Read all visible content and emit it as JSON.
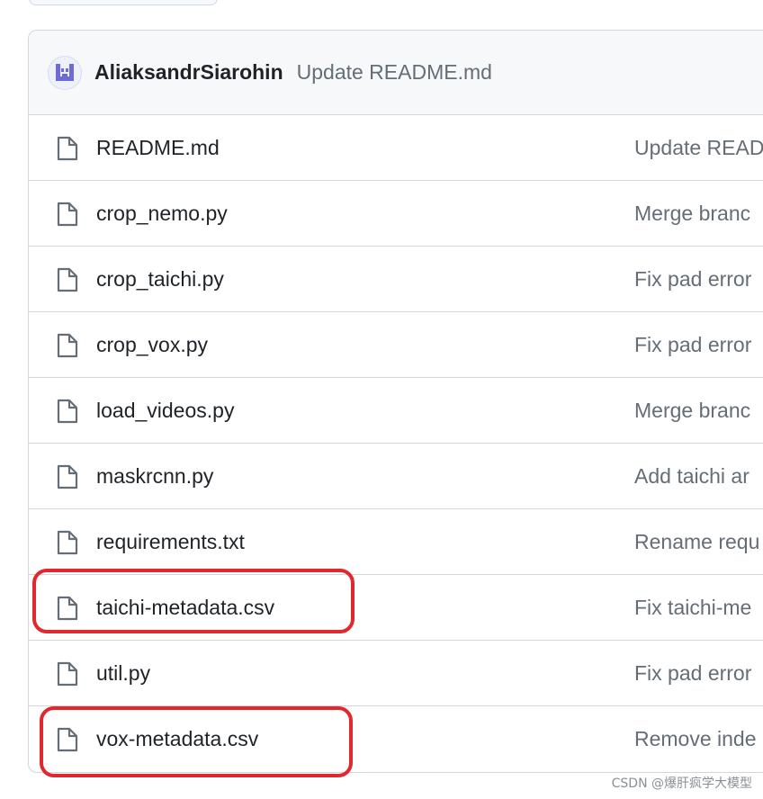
{
  "latest_commit": {
    "author": "AliaksandrSiarohin",
    "message": "Update README.md",
    "avatar_icon": "identicon-avatar"
  },
  "files": [
    {
      "name": "README.md",
      "commit": "Update READM",
      "icon": "file-icon"
    },
    {
      "name": "crop_nemo.py",
      "commit": "Merge branc",
      "icon": "file-icon"
    },
    {
      "name": "crop_taichi.py",
      "commit": "Fix pad error",
      "icon": "file-icon"
    },
    {
      "name": "crop_vox.py",
      "commit": "Fix pad error",
      "icon": "file-icon"
    },
    {
      "name": "load_videos.py",
      "commit": "Merge branc",
      "icon": "file-icon"
    },
    {
      "name": "maskrcnn.py",
      "commit": "Add taichi ar",
      "icon": "file-icon"
    },
    {
      "name": "requirements.txt",
      "commit": "Rename requ",
      "icon": "file-icon"
    },
    {
      "name": "taichi-metadata.csv",
      "commit": "Fix taichi-me",
      "icon": "file-icon"
    },
    {
      "name": "util.py",
      "commit": "Fix pad error",
      "icon": "file-icon"
    },
    {
      "name": "vox-metadata.csv",
      "commit": "Remove inde",
      "icon": "file-icon"
    }
  ],
  "highlighted_files": [
    "taichi-metadata.csv",
    "vox-metadata.csv"
  ],
  "highlight_color": "#e0282e",
  "watermark": "CSDN @爆肝疯学大模型"
}
